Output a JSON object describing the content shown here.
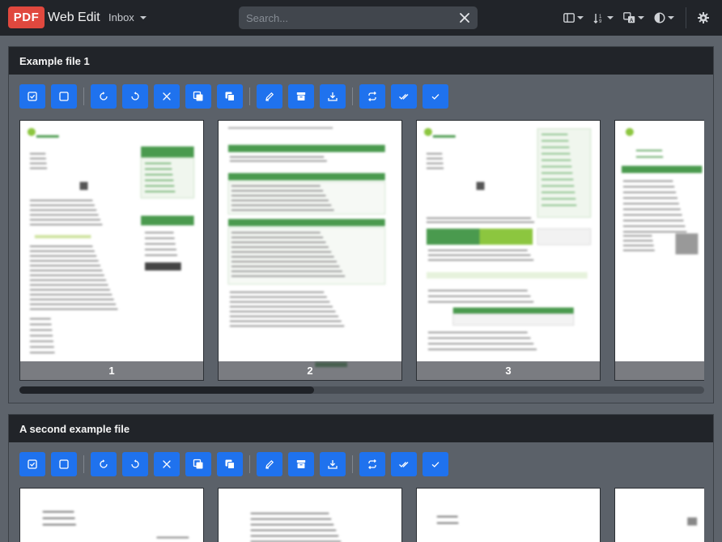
{
  "navbar": {
    "logo_text": "PDF",
    "app_name": "Web Edit",
    "inbox_label": "Inbox",
    "search_placeholder": "Search...",
    "icons": [
      "layout-columns-icon",
      "sort-icon",
      "translate-icon",
      "contrast-icon",
      "gear-icon"
    ]
  },
  "toolbar": {
    "buttons": [
      "select-all-icon",
      "deselect-icon",
      "rotate-right-icon",
      "rotate-left-icon",
      "delete-icon",
      "duplicate-icon",
      "copy-icon",
      "edit-icon",
      "archive-icon",
      "download-icon",
      "repeat-icon",
      "check-double-icon",
      "check-icon"
    ]
  },
  "files": [
    {
      "title": "Example file 1",
      "pages": [
        {
          "label": "1"
        },
        {
          "label": "2"
        },
        {
          "label": "3"
        },
        {
          "label": ""
        }
      ],
      "scroll_fraction": 0.43
    },
    {
      "title": "A second example file",
      "pages": [
        {
          "label": ""
        },
        {
          "label": ""
        },
        {
          "label": ""
        },
        {
          "label": ""
        }
      ]
    }
  ],
  "colors": {
    "accent": "#1f72ee",
    "logo": "#e0483e",
    "navbar": "#212429",
    "background": "#5d636b",
    "doc_green": "#4a9a4e",
    "doc_lime": "#8cc63f"
  }
}
